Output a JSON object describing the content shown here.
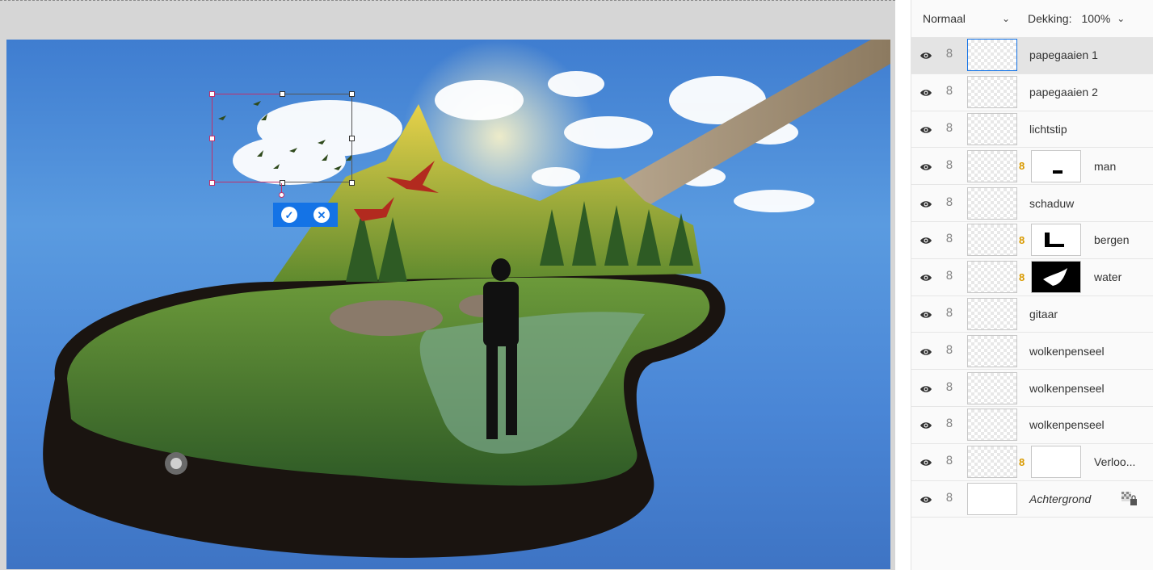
{
  "layers_panel": {
    "blend_mode": "Normaal",
    "opacity_label": "Dekking:",
    "opacity_value": "100%",
    "layers": [
      {
        "name": "papegaaien 1",
        "selected": true,
        "has_mask": false
      },
      {
        "name": "papegaaien 2",
        "selected": false,
        "has_mask": false
      },
      {
        "name": "lichtstip",
        "selected": false,
        "has_mask": false
      },
      {
        "name": "man",
        "selected": false,
        "has_mask": true
      },
      {
        "name": "schaduw",
        "selected": false,
        "has_mask": false
      },
      {
        "name": "bergen",
        "selected": false,
        "has_mask": true
      },
      {
        "name": "water",
        "selected": false,
        "has_mask": true
      },
      {
        "name": "gitaar",
        "selected": false,
        "has_mask": false
      },
      {
        "name": "wolkenpenseel",
        "selected": false,
        "has_mask": false
      },
      {
        "name": "wolkenpenseel",
        "selected": false,
        "has_mask": false
      },
      {
        "name": "wolkenpenseel",
        "selected": false,
        "has_mask": false
      },
      {
        "name": "Verloo...",
        "selected": false,
        "has_mask": true
      },
      {
        "name": "Achtergrond",
        "selected": false,
        "has_mask": false,
        "locked": true
      }
    ]
  },
  "transform": {
    "commit_icon": "checkmark-icon",
    "cancel_icon": "cancel-icon"
  },
  "colors": {
    "accent": "#1473e6",
    "selection_pink": "#c0306a",
    "sky": "#4a86d6"
  }
}
